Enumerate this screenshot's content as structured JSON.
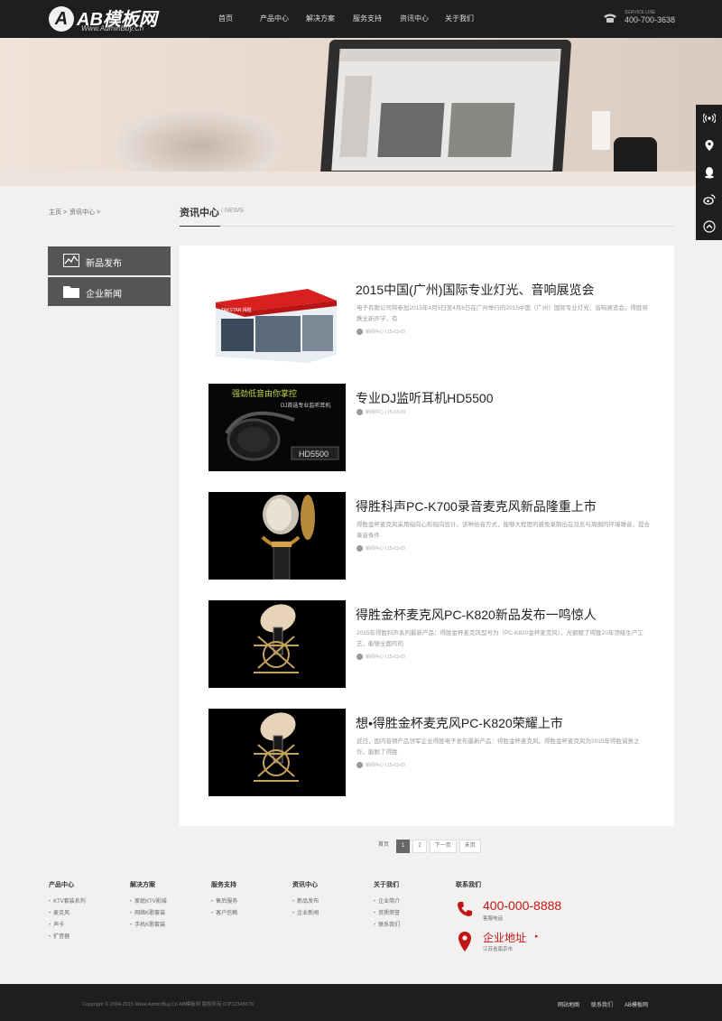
{
  "header": {
    "logo_mark": "A",
    "logo_text": "AB模板网",
    "logo_sub": "Www.AdminBuy.Cn",
    "nav": [
      "首页",
      "产品中心",
      "解决方案",
      "服务支持",
      "资讯中心",
      "关于我们"
    ],
    "hotline_label": "SERVICE LINE",
    "hotline_number": "400-700-3638"
  },
  "side_toolbar": [
    "signal-icon",
    "location-icon",
    "qq-icon",
    "weibo-icon",
    "back-to-top-icon"
  ],
  "breadcrumb": [
    "主页 >",
    "资讯中心 >"
  ],
  "section": {
    "title": "资讯中心",
    "sub": "/ NEWS"
  },
  "categories": [
    "新品发布",
    "企业新闻"
  ],
  "news": [
    {
      "title": "2015中国(广州)国际专业灯光、音响展览会",
      "summary": "电子有限公司将参加2015年4月5日至4月8日在广州举行的2015中国（广州）国际专业灯光、音响展览会。得胜将携全新声学、有",
      "meta": "新闻中心 | 15-03-03"
    },
    {
      "title": "专业DJ监听耳机HD5500",
      "summary": "",
      "meta": "新闻中心 | 15-03-03"
    },
    {
      "title": "得胜科声PC-K700录音麦克风新品隆重上市",
      "summary": "得胜金杯麦克风采用指向心形指向设计，该种拾音方式，能够大程度的避免录制出在见反与周围的环境噪音，提合录音条件",
      "meta": "新闻中心 | 15-03-03"
    },
    {
      "title": "得胜金杯麦克风PC-K820新品发布一鸣惊人",
      "summary": "2015年得胜科声系列最新产品：得胜金杯麦克风型号为（PC-K820金杯麦克风），光额赋了得胜20年顶级生产工艺，能够全面的的",
      "meta": "新闻中心 | 15-03-03"
    },
    {
      "title": "想•得胜金杯麦克风PC-K820荣耀上市",
      "summary": "近日，国内音频产品领军企业得胜电子发布最新产品：得胜金杯麦克风。得胜金杯麦克风为2015年得胜诚意之作，能耐了得胜",
      "meta": "新闻中心 | 15-03-03"
    }
  ],
  "thumb_texts": {
    "booth_brand": "TAKSTAR 得胜",
    "headphone_line1": "强劲低音由你掌控",
    "headphone_line2": "DJ首选专业监听耳机",
    "headphone_model": "HD5500"
  },
  "pager": [
    "首页",
    "1",
    "2",
    "下一页",
    "末页"
  ],
  "footer": {
    "columns": [
      {
        "title": "产品中心",
        "links": [
          "KTV套装系列",
          "麦克风",
          "声卡",
          "扩音器"
        ]
      },
      {
        "title": "解决方案",
        "links": [
          "家庭KTV影城",
          "网络K歌套装",
          "手机K歌套装"
        ]
      },
      {
        "title": "服务支持",
        "links": [
          "售后服务",
          "客户信赖"
        ]
      },
      {
        "title": "资讯中心",
        "links": [
          "新品发布",
          "企业新闻"
        ]
      },
      {
        "title": "关于我们",
        "links": [
          "企业简介",
          "资质荣誉",
          "联系我们"
        ]
      }
    ],
    "contact_title": "联系我们",
    "tel": "400-000-8888",
    "tel_label": "客服电话",
    "addr_title": "企业地址",
    "addr_text": "江苏省南京市"
  },
  "bottom": {
    "copyright": "Copyright © 2004-2015 Www.AdminBuy.Cn AB模板网 版权所有 ICP12345678",
    "links": [
      "网站地图",
      "联系我们",
      "AB模板网"
    ]
  },
  "colors": {
    "accent_red": "#c21616",
    "header_bg": "#1e1e1e",
    "menu_bg": "#555555"
  }
}
